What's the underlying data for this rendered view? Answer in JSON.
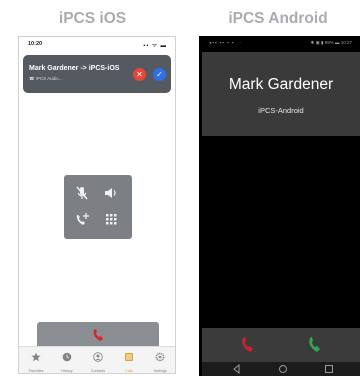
{
  "headings": {
    "ios": "iPCS iOS",
    "android": "iPCS Android"
  },
  "ios": {
    "status_time": "10:20",
    "status_icons": "▪▪ ᯤ ▬",
    "banner": {
      "caller": "Mark Gardener -> iPCS-iOS",
      "subtitle": "☎ iPCS Audio..."
    },
    "tabs": [
      {
        "label": "Favorites",
        "icon": "star-icon"
      },
      {
        "label": "History",
        "icon": "history-icon"
      },
      {
        "label": "Contacts",
        "icon": "contacts-icon"
      },
      {
        "label": "Calls",
        "icon": "calls-icon"
      },
      {
        "label": "Settings",
        "icon": "settings-icon"
      }
    ],
    "colors": {
      "decline": "#e7453b",
      "accept": "#2f6fe8",
      "active_tab": "#e2a32e"
    }
  },
  "android": {
    "status_left": "◂▪▪ ▪▪ ▪ ▪ ··",
    "status_right": "✱ ▣ ▮ 99% ▬ 10:27",
    "caller": "Mark Gardener",
    "subtitle": "iPCS-Android",
    "colors": {
      "decline": "#c9232b",
      "accept": "#2fa84f"
    }
  }
}
